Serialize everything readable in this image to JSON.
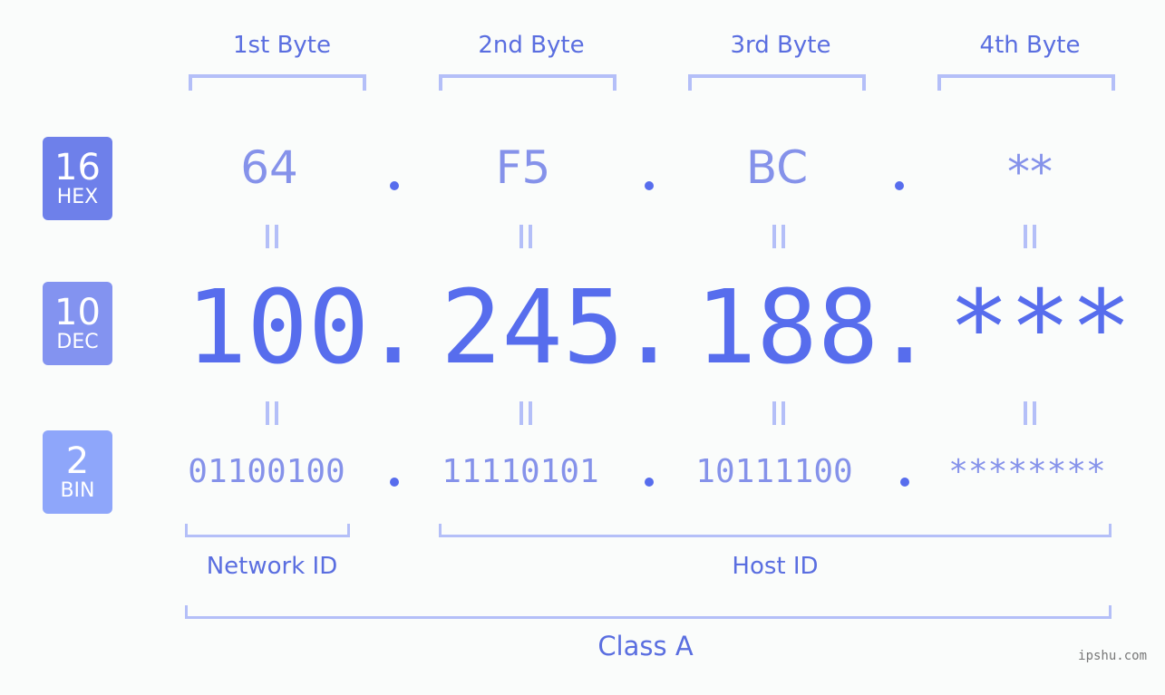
{
  "bytes": {
    "headers": [
      "1st Byte",
      "2nd Byte",
      "3rd Byte",
      "4th Byte"
    ]
  },
  "badges": {
    "hex": {
      "num": "16",
      "label": "HEX",
      "color": "#6e80ea"
    },
    "dec": {
      "num": "10",
      "label": "DEC",
      "color": "#8393f0"
    },
    "bin": {
      "num": "2",
      "label": "BIN",
      "color": "#8ea6fa"
    }
  },
  "hex": [
    "64",
    "F5",
    "BC",
    "**"
  ],
  "dec": [
    "100",
    "245",
    "188",
    "***"
  ],
  "dec_separator": ".",
  "bin": [
    "01100100",
    "11110101",
    "10111100",
    "********"
  ],
  "labels": {
    "network_id": "Network ID",
    "host_id": "Host ID",
    "class": "Class A"
  },
  "watermark": "ipshu.com",
  "colors": {
    "accent": "#576ded",
    "bracket": "#b4bff8",
    "value_light": "#8592ea"
  }
}
